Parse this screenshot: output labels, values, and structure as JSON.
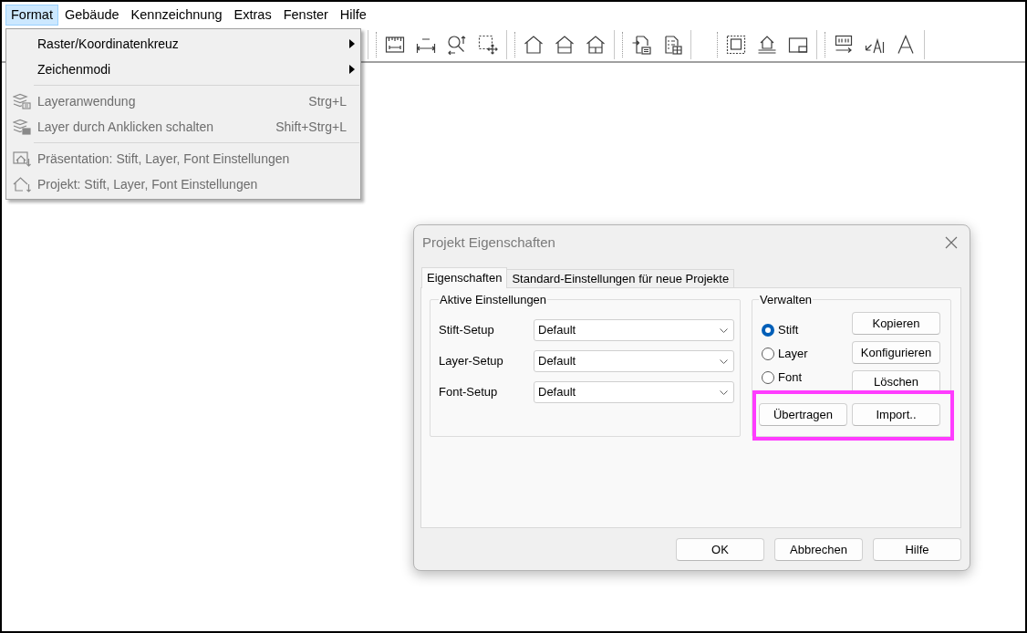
{
  "menu_bar": [
    {
      "label": "Format",
      "selected": true
    },
    {
      "label": "Gebäude",
      "selected": false
    },
    {
      "label": "Kennzeichnung",
      "selected": false
    },
    {
      "label": "Extras",
      "selected": false
    },
    {
      "label": "Fenster",
      "selected": false
    },
    {
      "label": "Hilfe",
      "selected": false
    }
  ],
  "format_menu": [
    {
      "kind": "submenu",
      "label": "Raster/Koordinatenkreuz",
      "disabled": false
    },
    {
      "kind": "submenu",
      "label": "Zeichenmodi",
      "disabled": false
    },
    {
      "kind": "separator"
    },
    {
      "kind": "command",
      "label": "Layeranwendung",
      "shortcut": "Strg+L",
      "disabled": true
    },
    {
      "kind": "command",
      "label": "Layer durch Anklicken schalten",
      "shortcut": "Shift+Strg+L",
      "disabled": true
    },
    {
      "kind": "separator"
    },
    {
      "kind": "command",
      "label": "Präsentation: Stift, Layer, Font Einstellungen",
      "disabled": true
    },
    {
      "kind": "command",
      "label": "Projekt: Stift, Layer, Font Einstellungen",
      "disabled": true
    }
  ],
  "dialog": {
    "title": "Projekt Eigenschaften",
    "tabs": [
      {
        "label": "Eigenschaften",
        "selected": true
      },
      {
        "label": "Standard-Einstellungen für neue Projekte",
        "selected": false
      }
    ],
    "active_settings": {
      "title": "Aktive Einstellungen",
      "rows": [
        {
          "label": "Stift-Setup",
          "value": "Default"
        },
        {
          "label": "Layer-Setup",
          "value": "Default"
        },
        {
          "label": "Font-Setup",
          "value": "Default"
        }
      ]
    },
    "manage": {
      "title": "Verwalten",
      "options": [
        {
          "label": "Stift",
          "selected": true
        },
        {
          "label": "Layer",
          "selected": false
        },
        {
          "label": "Font",
          "selected": false
        }
      ],
      "buttons": [
        "Kopieren",
        "Konfigurieren",
        "Löschen"
      ],
      "transfer_buttons": [
        "Übertragen",
        "Import.."
      ]
    },
    "buttons": [
      "OK",
      "Abbrechen",
      "Hilfe"
    ]
  }
}
